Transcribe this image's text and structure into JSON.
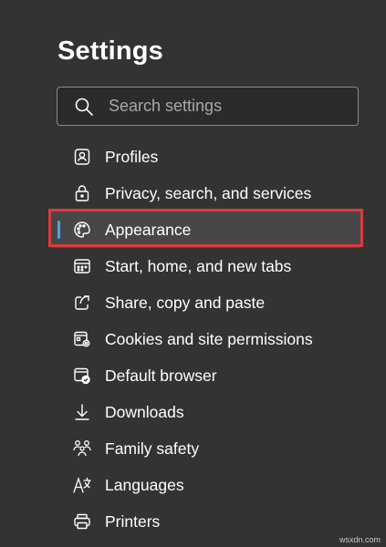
{
  "page": {
    "title": "Settings"
  },
  "search": {
    "placeholder": "Search settings",
    "icon": "search-icon"
  },
  "nav": {
    "active_index": 2,
    "indicator_color": "#4fa3e4",
    "highlight_color": "#e0383e",
    "items": [
      {
        "label": "Profiles",
        "icon": "profile-icon"
      },
      {
        "label": "Privacy, search, and services",
        "icon": "lock-icon"
      },
      {
        "label": "Appearance",
        "icon": "palette-icon"
      },
      {
        "label": "Start, home, and new tabs",
        "icon": "start-page-icon"
      },
      {
        "label": "Share, copy and paste",
        "icon": "share-icon"
      },
      {
        "label": "Cookies and site permissions",
        "icon": "cookies-permissions-icon"
      },
      {
        "label": "Default browser",
        "icon": "default-browser-icon"
      },
      {
        "label": "Downloads",
        "icon": "download-icon"
      },
      {
        "label": "Family safety",
        "icon": "family-icon"
      },
      {
        "label": "Languages",
        "icon": "language-icon"
      },
      {
        "label": "Printers",
        "icon": "printer-icon"
      }
    ]
  },
  "watermark": "wsxdn.com"
}
